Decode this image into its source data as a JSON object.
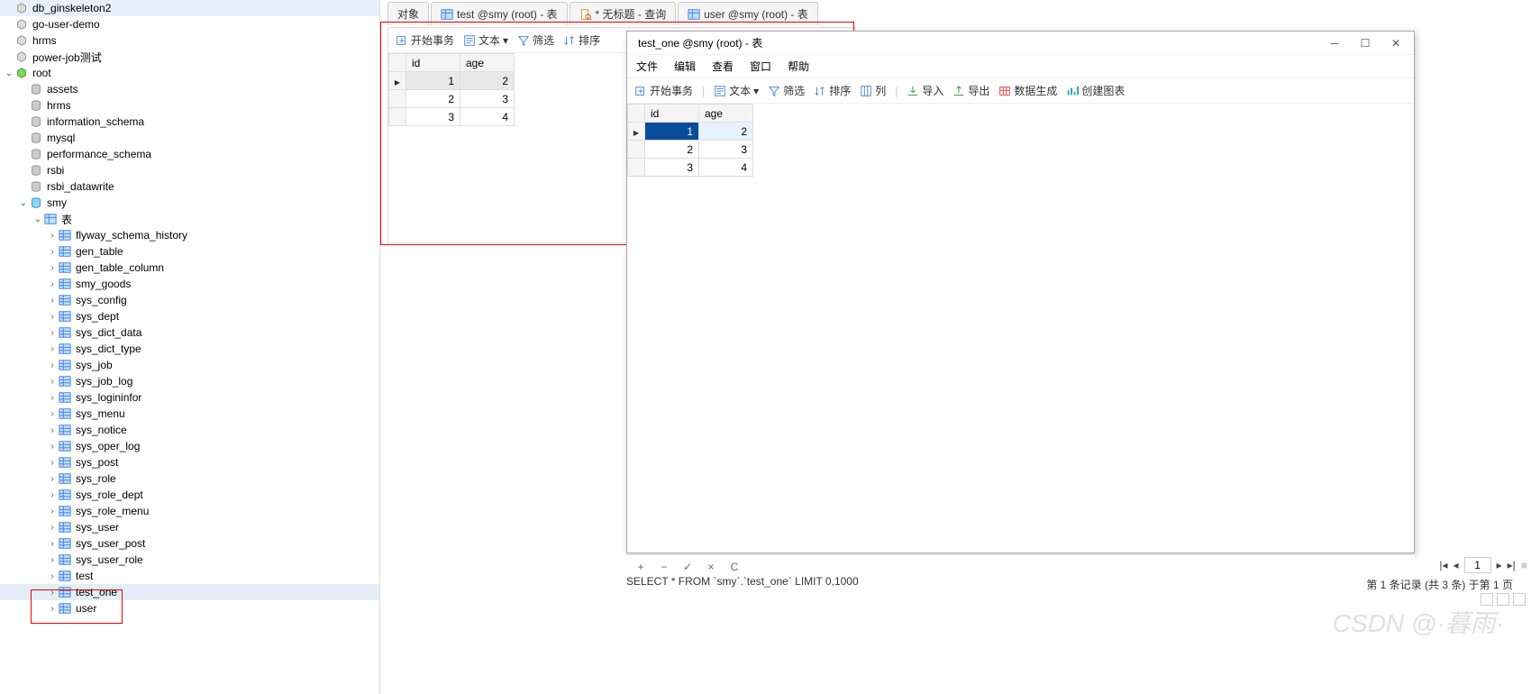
{
  "sidebar": {
    "connections": [
      {
        "name": "db_ginskeleton2",
        "kind": "conn"
      },
      {
        "name": "go-user-demo",
        "kind": "conn"
      },
      {
        "name": "hrms",
        "kind": "conn"
      },
      {
        "name": "power-job测试",
        "kind": "conn"
      }
    ],
    "root_label": "root",
    "databases": [
      "assets",
      "hrms",
      "information_schema",
      "mysql",
      "performance_schema",
      "rsbi",
      "rsbi_datawrite"
    ],
    "active_db": "smy",
    "tables_folder": "表",
    "tables": [
      "flyway_schema_history",
      "gen_table",
      "gen_table_column",
      "smy_goods",
      "sys_config",
      "sys_dept",
      "sys_dict_data",
      "sys_dict_type",
      "sys_job",
      "sys_job_log",
      "sys_logininfor",
      "sys_menu",
      "sys_notice",
      "sys_oper_log",
      "sys_post",
      "sys_role",
      "sys_role_dept",
      "sys_role_menu",
      "sys_user",
      "sys_user_post",
      "sys_user_role",
      "test",
      "test_one",
      "user"
    ],
    "highlight": [
      "test",
      "test_one"
    ]
  },
  "tabs": [
    {
      "label": "对象",
      "icon": "none"
    },
    {
      "label": "test @smy (root) - 表",
      "icon": "table"
    },
    {
      "label": "* 无标题 - 查询",
      "icon": "query"
    },
    {
      "label": "user @smy (root) - 表",
      "icon": "table"
    }
  ],
  "toolbar": {
    "begin_txn": "开始事务",
    "text": "文本",
    "filter": "筛选",
    "sort": "排序",
    "column": "列",
    "import": "导入",
    "export": "导出",
    "datagen": "数据生成",
    "chart": "创建图表"
  },
  "grid_left": {
    "headers": [
      "id",
      "age"
    ],
    "rows": [
      {
        "id": 1,
        "age": 2
      },
      {
        "id": 2,
        "age": 3
      },
      {
        "id": 3,
        "age": 4
      }
    ],
    "selected_row": 0
  },
  "popup": {
    "title": "test_one @smy (root) - 表",
    "menus": [
      "文件",
      "编辑",
      "查看",
      "窗口",
      "帮助"
    ],
    "grid": {
      "headers": [
        "id",
        "age"
      ],
      "rows": [
        {
          "id": 1,
          "age": 2
        },
        {
          "id": 2,
          "age": 3
        },
        {
          "id": 3,
          "age": 4
        }
      ],
      "selected_row": 0
    }
  },
  "status": {
    "btns": [
      "+",
      "−",
      "✓",
      "×",
      "C"
    ],
    "sql": "SELECT * FROM `smy`.`test_one` LIMIT 0,1000",
    "page_input": "1",
    "record_info": "第 1 条记录 (共 3 条) 于第 1 页"
  },
  "watermark": "CSDN @·暮雨·"
}
